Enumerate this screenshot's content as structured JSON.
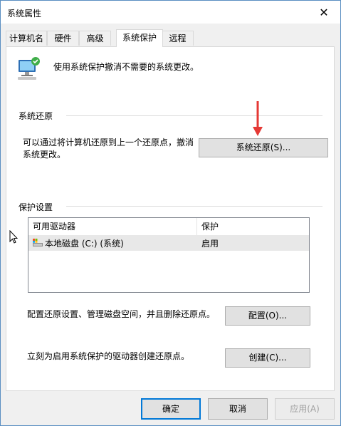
{
  "window": {
    "title": "系统属性",
    "close_label": "✕"
  },
  "tabs": [
    {
      "label": "计算机名"
    },
    {
      "label": "硬件"
    },
    {
      "label": "高级"
    },
    {
      "label": "系统保护",
      "active": true
    },
    {
      "label": "远程"
    }
  ],
  "intro": {
    "text": "使用系统保护撤消不需要的系统更改。"
  },
  "restore": {
    "group_title": "系统还原",
    "description": "可以通过将计算机还原到上一个还原点，撤消系统更改。",
    "button_label": "系统还原(S)..."
  },
  "protection": {
    "group_title": "保护设置",
    "columns": [
      "可用驱动器",
      "保护"
    ],
    "drives": [
      {
        "name": "本地磁盘 (C:) (系统)",
        "status": "启用"
      }
    ],
    "configure_text": "配置还原设置、管理磁盘空间，并且删除还原点。",
    "configure_button": "配置(O)...",
    "create_text": "立刻为启用系统保护的驱动器创建还原点。",
    "create_button": "创建(C)..."
  },
  "footer": {
    "ok": "确定",
    "cancel": "取消",
    "apply": "应用(A)"
  },
  "colors": {
    "arrow": "#e53935",
    "focus_border": "#0078d7",
    "disabled_text": "#a0a0a0"
  }
}
